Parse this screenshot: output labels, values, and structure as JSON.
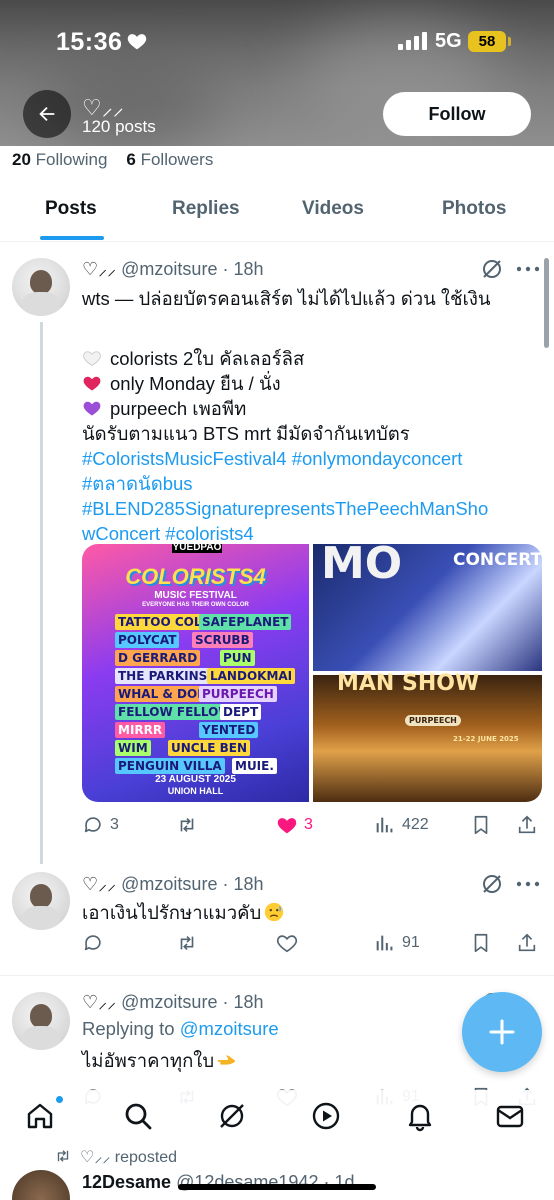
{
  "status_bar": {
    "time": "15:36",
    "network": "5G",
    "battery": "58"
  },
  "profile": {
    "name": "♡⸝⸝",
    "posts_count": "120 posts",
    "follow_label": "Follow"
  },
  "follow_counts": {
    "following_num": "20",
    "following_label": "Following",
    "followers_num": "6",
    "followers_label": "Followers"
  },
  "tabs": [
    {
      "label": "Posts",
      "active": true
    },
    {
      "label": "Replies",
      "active": false
    },
    {
      "label": "Videos",
      "active": false
    },
    {
      "label": "Photos",
      "active": false
    }
  ],
  "posts": [
    {
      "name": "♡⸝⸝",
      "handle": "@mzoitsure",
      "time": "18h",
      "line1": "wts — ปล่อยบัตรคอนเสิร์ต ไม่ได้ไปแล้ว ด่วน ใช้เงิน",
      "line2": "colorists 2ใบ คัลเลอร์ลิส",
      "line3": "only Monday ยืน / นั่ง",
      "line4": "purpeech เพอพีท",
      "line5": "นัดรับตามแนว BTS mrt มีมัดจำกันเทบัตร",
      "hashtag_line1_a": "#ColoristsMusicFestival4",
      "hashtag_line1_b": "#onlymondayconcert",
      "hashtag_line2": "#ตลาดนัดbus",
      "hashtag_line3": "#BLEND285SignaturepresentsThePeechManSho",
      "hashtag_line4_a": "wConcert",
      "hashtag_line4_b": "#colorists4",
      "media": {
        "poster_top": "YUEDPAO",
        "poster_title": "COLORISTS4",
        "poster_sub": "MUSIC FESTIVAL",
        "poster_tag": "EVERYONE HAS THEIR OWN COLOR",
        "lineup": [
          "TATTOO COLOUR",
          "SAFEPLANET",
          "POLYCAT",
          "SCRUBB",
          "D GERRARD",
          "PUN",
          "THE PARKINSON",
          "LANDOKMAI",
          "WHAL & DOLPH",
          "PURPEECH",
          "FELLOW FELLOW",
          "DEPT",
          "MIRRR",
          "YENTED",
          "WIM",
          "UNCLE BEN",
          "PENGUIN VILLA",
          "MUIE."
        ],
        "poster_date": "23 AUGUST 2025",
        "poster_venue": "UNION HALL",
        "rt_text": "CONCERT",
        "rt_big": "MO",
        "rb_big": "MAN SHOW",
        "rb_brand": "PURPEECH",
        "rb_date": "21-22 JUNE 2025"
      },
      "replies": "3",
      "likes": "3",
      "views": "422",
      "liked": true
    },
    {
      "name": "♡⸝⸝",
      "handle": "@mzoitsure",
      "time": "18h",
      "text": "เอาเงินไปรักษาแมวคับ",
      "views": "91"
    },
    {
      "name": "♡⸝⸝",
      "handle": "@mzoitsure",
      "time": "18h",
      "replying_prefix": "Replying to",
      "replying_handle": "@mzoitsure",
      "text": "ไม่อัพราคาทุกใบ",
      "views": "91"
    }
  ],
  "repost": {
    "label": "♡⸝⸝ reposted",
    "name": "12Desame",
    "handle": "@12desame1942",
    "time": "1d"
  },
  "colors": {
    "accent": "#1d9bf0",
    "like": "#f91880",
    "secondary_text": "#536471",
    "fab": "#5db8f3",
    "battery": "#e8c21f"
  },
  "icons": [
    "back-arrow-icon",
    "heart-icon",
    "grok-icon",
    "more-icon",
    "reply-icon",
    "repost-icon",
    "like-icon",
    "views-icon",
    "bookmark-icon",
    "share-icon",
    "compose-icon",
    "home-icon",
    "search-icon",
    "grok-nav-icon",
    "video-icon",
    "notifications-icon",
    "messages-icon"
  ]
}
